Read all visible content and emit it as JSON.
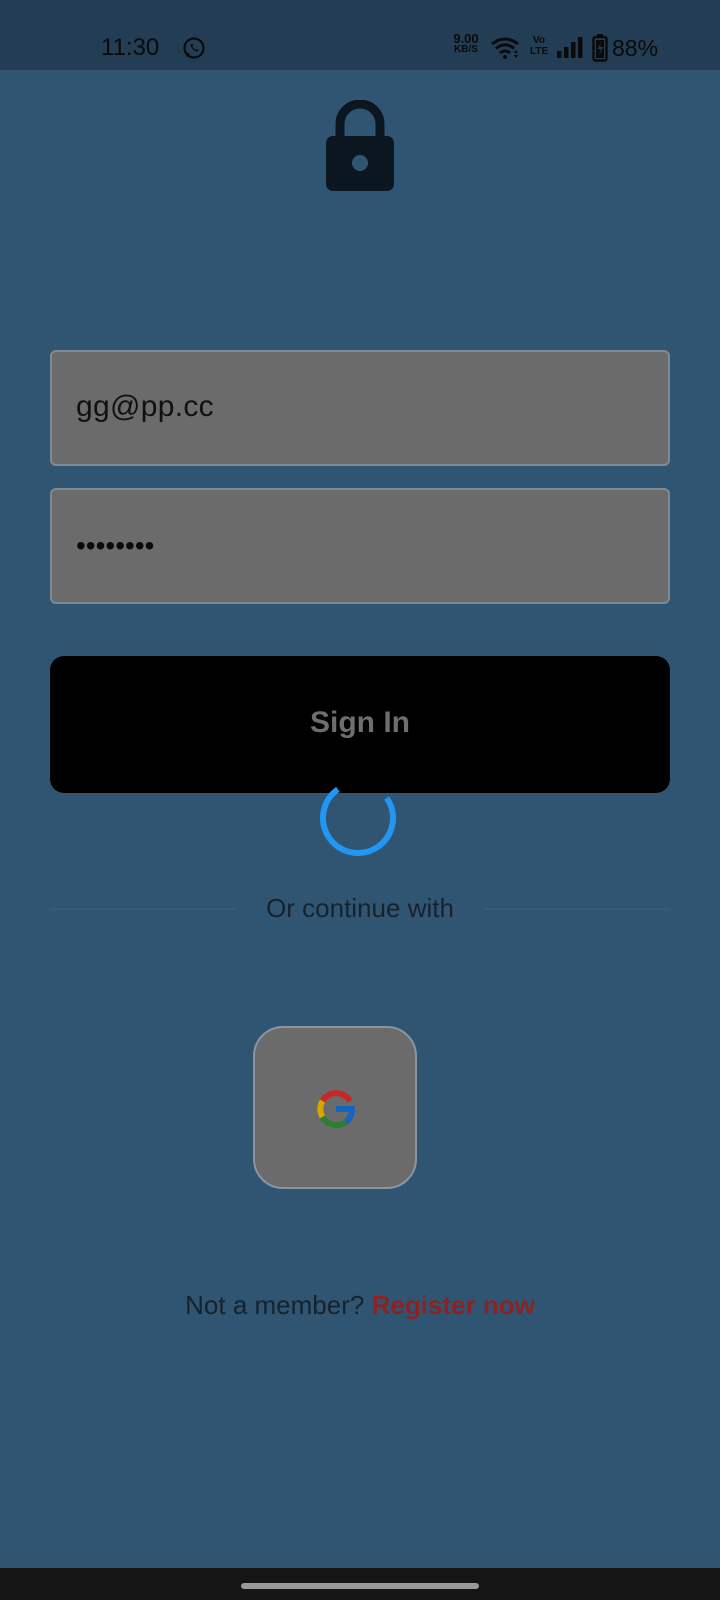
{
  "status_bar": {
    "time": "11:30",
    "net_rate": "9.00",
    "net_unit": "KB/S",
    "volte_top": "Vo",
    "volte_bottom": "LTE",
    "battery": "88%",
    "icons": [
      "whatsapp-icon",
      "wifi-icon",
      "volte-icon",
      "signal-icon",
      "battery-icon"
    ]
  },
  "header": {
    "icon": "lock-icon"
  },
  "form": {
    "email_value": "gg@pp.cc",
    "password_mask": "••••••••",
    "signin_label": "Sign In"
  },
  "divider": {
    "text": "Or continue with"
  },
  "social": {
    "google_icon": "google-icon"
  },
  "footer": {
    "prompt": "Not a member?",
    "link": "Register now"
  },
  "colors": {
    "background": "#2f5573",
    "status_bar": "#233d55",
    "field_bg": "#6b6b6b",
    "button_bg": "#000000",
    "spinner": "#2196f3",
    "link": "#8b2323"
  }
}
